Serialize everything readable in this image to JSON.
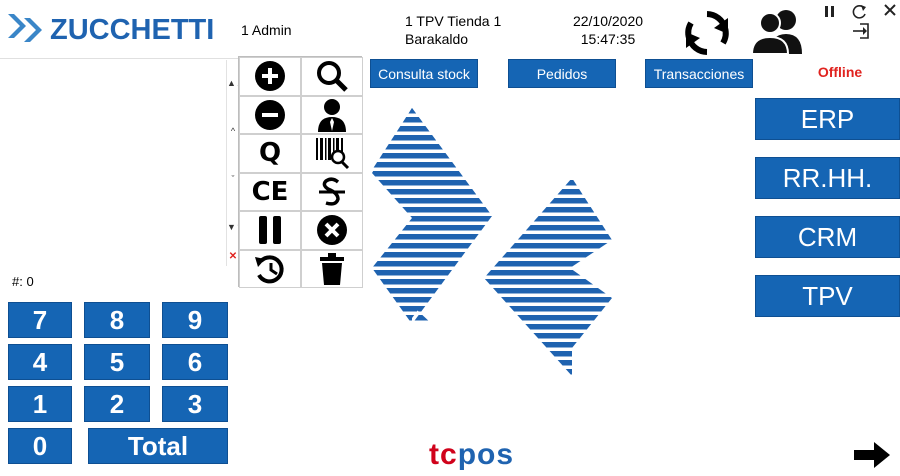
{
  "header": {
    "brand": "ZUCCHETTI",
    "user": "1 Admin",
    "terminal_line1": "1 TPV Tienda 1",
    "terminal_line2": "Barakaldo",
    "date": "22/10/2020",
    "time": "15:47:35",
    "icons": [
      "sync-icon",
      "users-icon",
      "pause-icon",
      "refresh-icon",
      "close-icon",
      "logout-icon"
    ]
  },
  "ticket": {
    "count_label": "#: 0"
  },
  "function_buttons": {
    "quantity_label": "Q",
    "clear_entry_label": "CE",
    "icons": [
      "plus-icon",
      "search-icon",
      "minus-icon",
      "customer-icon",
      "barcode-search-icon",
      "strikethrough-icon",
      "pause-icon",
      "cancel-icon",
      "history-icon",
      "trash-icon"
    ]
  },
  "top_buttons": {
    "stock": "Consulta stock",
    "orders": "Pedidos",
    "transactions": "Transacciones"
  },
  "status": {
    "offline": "Offline"
  },
  "side_buttons": {
    "erp": "ERP",
    "hr": "RR.HH.",
    "crm": "CRM",
    "tpv": "TPV"
  },
  "numpad": {
    "k7": "7",
    "k8": "8",
    "k9": "9",
    "k4": "4",
    "k5": "5",
    "k6": "6",
    "k1": "1",
    "k2": "2",
    "k3": "3",
    "k0": "0",
    "total": "Total"
  },
  "footer": {
    "brand": "tcpos"
  },
  "colors": {
    "primary_blue": "#1565b4",
    "offline_red": "#e0231f",
    "brand_red": "#d0021b"
  }
}
